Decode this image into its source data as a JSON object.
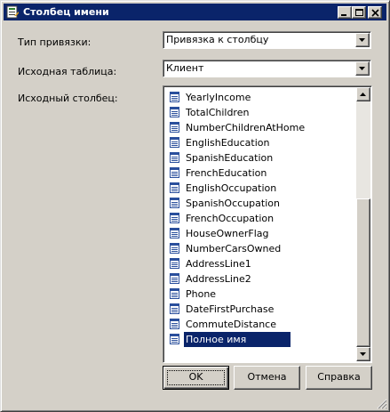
{
  "window": {
    "title": "Столбец имени"
  },
  "caption_buttons": {
    "minimize": "minimize-icon",
    "maximize": "maximize-icon",
    "close": "close-icon"
  },
  "fields": {
    "binding_type": {
      "label": "Тип привязки:",
      "value": "Привязка к столбцу"
    },
    "source_table": {
      "label": "Исходная таблица:",
      "value": "Клиент"
    },
    "source_column": {
      "label": "Исходный столбец:"
    }
  },
  "columns": [
    {
      "name": "YearlyIncome",
      "selected": false
    },
    {
      "name": "TotalChildren",
      "selected": false
    },
    {
      "name": "NumberChildrenAtHome",
      "selected": false
    },
    {
      "name": "EnglishEducation",
      "selected": false
    },
    {
      "name": "SpanishEducation",
      "selected": false
    },
    {
      "name": "FrenchEducation",
      "selected": false
    },
    {
      "name": "EnglishOccupation",
      "selected": false
    },
    {
      "name": "SpanishOccupation",
      "selected": false
    },
    {
      "name": "FrenchOccupation",
      "selected": false
    },
    {
      "name": "HouseOwnerFlag",
      "selected": false
    },
    {
      "name": "NumberCarsOwned",
      "selected": false
    },
    {
      "name": "AddressLine1",
      "selected": false
    },
    {
      "name": "AddressLine2",
      "selected": false
    },
    {
      "name": "Phone",
      "selected": false
    },
    {
      "name": "DateFirstPurchase",
      "selected": false
    },
    {
      "name": "CommuteDistance",
      "selected": false
    },
    {
      "name": "Полное имя",
      "selected": true
    }
  ],
  "buttons": {
    "ok": "OK",
    "cancel": "Отмена",
    "help": "Справка"
  },
  "colors": {
    "title_bar": "#0a246a",
    "face": "#d4d0c8",
    "selection": "#0a246a"
  }
}
